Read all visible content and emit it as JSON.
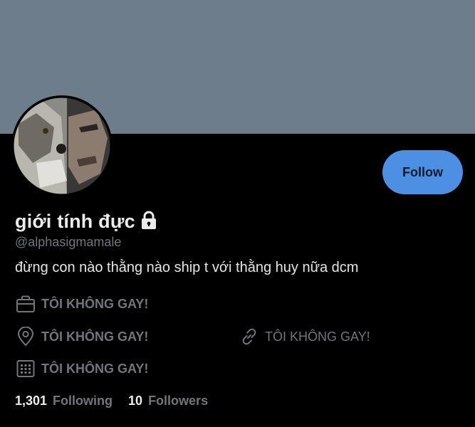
{
  "profile": {
    "display_name": "giới tính đực",
    "handle": "@alphasigmamale",
    "bio": "đừng con nào thằng nào ship t với thằng huy nữa dcm",
    "follow_label": "Follow",
    "category": "TÔI KHÔNG GAY!",
    "location": "TÔI KHÔNG GAY!",
    "website": "TÔI KHÔNG GAY!",
    "joined": "TÔI KHÔNG GAY!",
    "following_count": "1,301",
    "following_label": "Following",
    "followers_count": "10",
    "followers_label": "Followers"
  },
  "icons": {
    "protected": "lock-icon",
    "category": "briefcase-icon",
    "location": "location-pin-icon",
    "website": "link-icon",
    "joined": "calendar-icon"
  },
  "colors": {
    "banner": "#6e7d8c",
    "background": "#000000",
    "follow_button": "#4c8fe3",
    "muted_text": "#6f767d"
  }
}
